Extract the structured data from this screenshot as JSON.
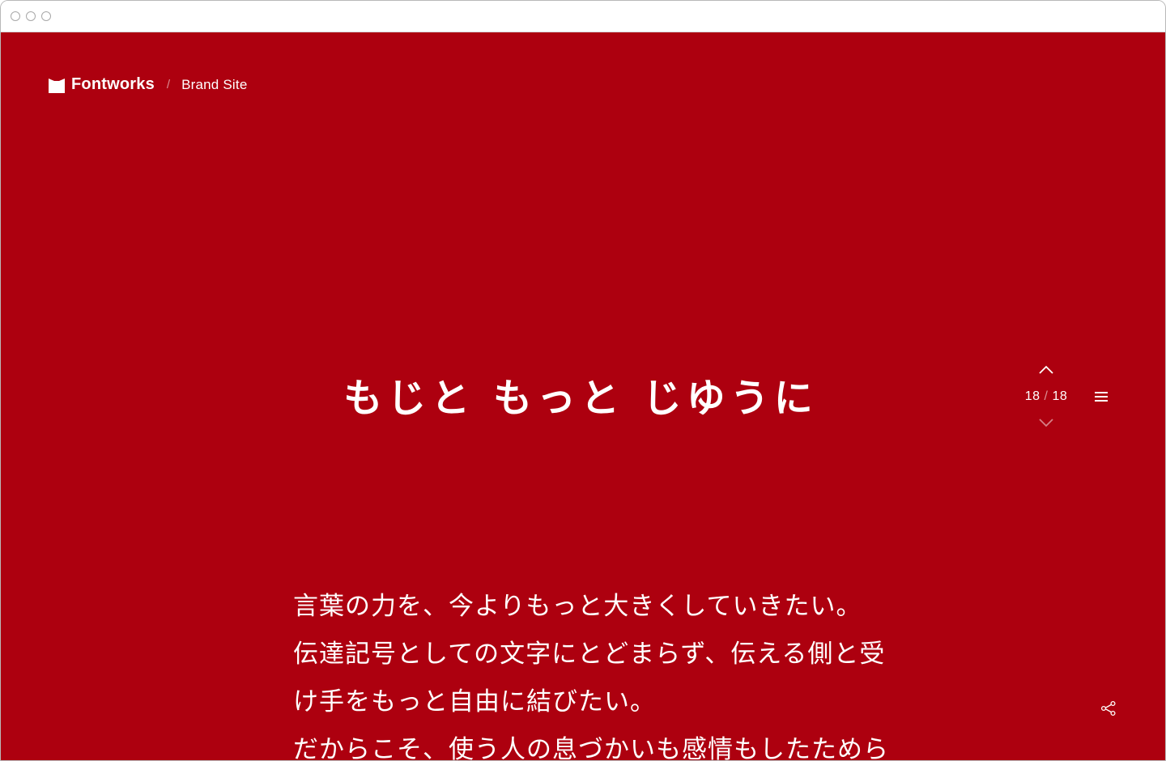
{
  "header": {
    "brand_name": "Fontworks",
    "separator": "/",
    "current_page": "Brand Site"
  },
  "hero": {
    "title": "もじと もっと じゆうに"
  },
  "slide_nav": {
    "current": "18",
    "separator": "/",
    "total": "18"
  },
  "body": {
    "lines": [
      "言葉の力を、今よりもっと大きくしていきたい。",
      "伝達記号としての文字にとどまらず、伝える側と受",
      "け手をもっと自由に結びたい。",
      "だからこそ、使う人の息づかいも感情もしたためら"
    ]
  },
  "colors": {
    "background": "#ad000f",
    "text": "#ffffff"
  },
  "icons": {
    "logo": "fontworks-logo-icon",
    "up": "chevron-up-icon",
    "down": "chevron-down-icon",
    "menu": "hamburger-menu-icon",
    "share": "share-icon"
  }
}
